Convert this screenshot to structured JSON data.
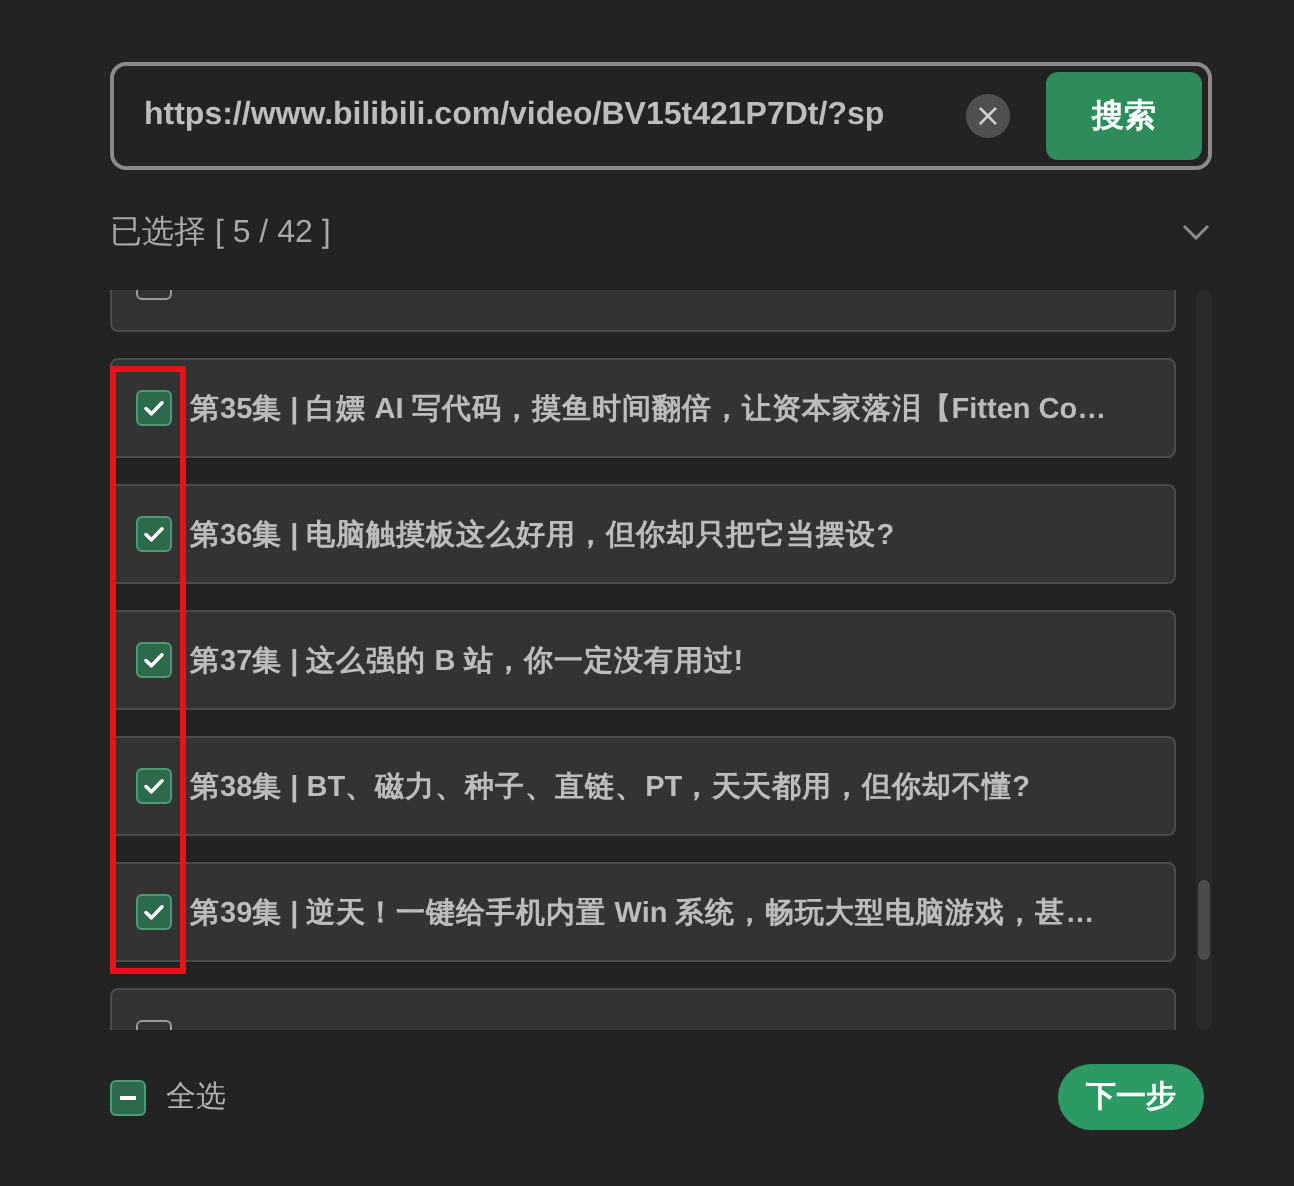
{
  "search": {
    "value": "https://www.bilibili.com/video/BV15t421P7Dt/?sp",
    "clear_icon": "×",
    "button": "搜索"
  },
  "selection": {
    "summary": "已选择 [ 5 / 42 ]",
    "expanded": true
  },
  "episodes": [
    {
      "checked": false
    },
    {
      "title": "第35集 | 白嫖 AI 写代码，摸鱼时间翻倍，让资本家落泪【Fitten Co…",
      "checked": true
    },
    {
      "title": "第36集 | 电脑触摸板这么好用，但你却只把它当摆设?",
      "checked": true
    },
    {
      "title": "第37集 | 这么强的 B 站，你一定没有用过!",
      "checked": true
    },
    {
      "title": "第38集 | BT、磁力、种子、直链、PT，天天都用，但你却不懂?",
      "checked": true
    },
    {
      "title": "第39集 | 逆天！一键给手机内置 Win 系统，畅玩大型电脑游戏，甚…",
      "checked": true
    },
    {
      "checked": false
    }
  ],
  "highlight": {
    "kind": "rectangle"
  },
  "select_all": {
    "label": "全选",
    "indeterminate": true
  },
  "next_button": "下一步"
}
